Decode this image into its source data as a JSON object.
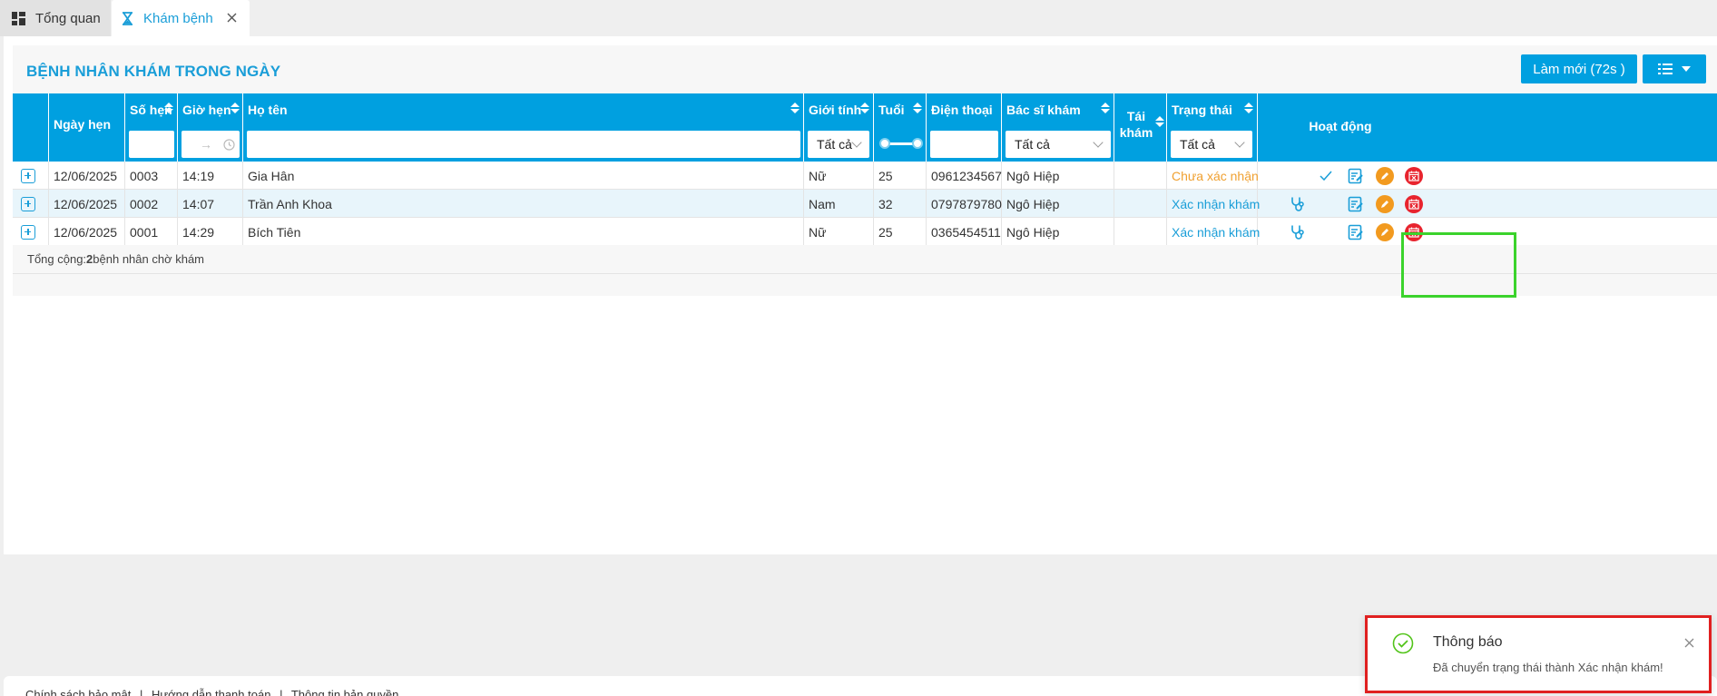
{
  "tabs": [
    {
      "label": "Tổng quan",
      "icon": "dashboard-icon"
    },
    {
      "label": "Khám bệnh",
      "icon": "hourglass-icon",
      "close": "X"
    }
  ],
  "panel": {
    "title": "BỆNH NHÂN KHÁM TRONG NGÀY",
    "refresh_label": "Làm mới (72s )",
    "columns_icon": "list-icon"
  },
  "table": {
    "headers": {
      "appt_date": "Ngày hẹn",
      "appt_no": "Số hẹn",
      "appt_time": "Giờ hẹn",
      "name": "Họ tên",
      "gender": "Giới tính",
      "age": "Tuổi",
      "phone": "Điện thoại",
      "doctor": "Bác sĩ khám",
      "revisit": "Tái khám",
      "status": "Trạng thái",
      "actions": "Hoạt động"
    },
    "filters": {
      "time_separator": "→",
      "gender": "Tất cả",
      "doctor": "Tất cả",
      "status": "Tất cả"
    },
    "rows": [
      {
        "date": "12/06/2025",
        "no": "0003",
        "time": "14:19",
        "name": "Gia Hân",
        "gender": "Nữ",
        "age": "25",
        "phone": "0961234567",
        "doctor": "Ngô Hiệp",
        "revisit": "",
        "status": "Chưa xác nhận"
      },
      {
        "date": "12/06/2025",
        "no": "0002",
        "time": "14:07",
        "name": "Trần Anh Khoa",
        "gender": "Nam",
        "age": "32",
        "phone": "0797879780",
        "doctor": "Ngô Hiệp",
        "revisit": "",
        "status": "Xác nhận khám"
      },
      {
        "date": "12/06/2025",
        "no": "0001",
        "time": "14:29",
        "name": "Bích Tiên",
        "gender": "Nữ",
        "age": "25",
        "phone": "0365454511",
        "doctor": "Ngô Hiệp",
        "revisit": "",
        "status": "Xác nhận khám"
      }
    ],
    "summary_prefix": "Tổng cộng: ",
    "summary_count": "2",
    "summary_suffix": " bệnh nhân chờ khám"
  },
  "footer": {
    "links": [
      "Chính sách bảo mật",
      "Hướng dẫn thanh toán",
      "Thông tin bản quyền"
    ],
    "separator": "|"
  },
  "toast": {
    "title": "Thông báo",
    "message": "Đã chuyển trạng thái thành Xác nhận khám!",
    "close": "X"
  },
  "colors": {
    "primary": "#00a0e0",
    "pending": "#f0a030",
    "edit_orange": "#f29a1f",
    "cancel_red": "#e8242e"
  }
}
